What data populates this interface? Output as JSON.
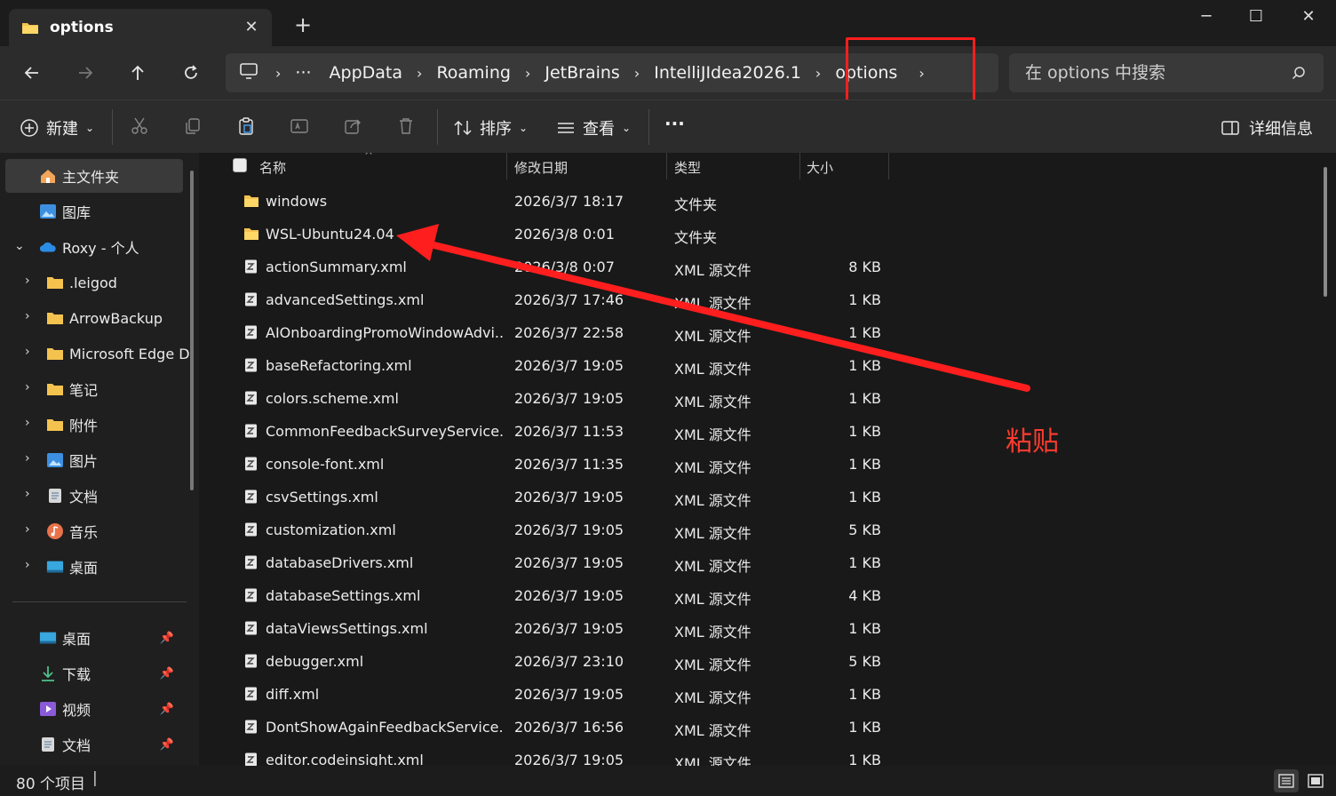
{
  "window": {
    "tab_title": "options",
    "tab_close": "✕",
    "new_tab": "+",
    "minimize": "─",
    "maximize": "☐",
    "close": "✕"
  },
  "nav": {
    "breadcrumbs": [
      "AppData",
      "Roaming",
      "JetBrains",
      "IntelliJIdea2026.1",
      "options"
    ],
    "overflow": "···",
    "search_placeholder": "在 options 中搜索"
  },
  "commands": {
    "new_label": "新建",
    "sort_label": "排序",
    "view_label": "查看",
    "more_label": "···",
    "details_label": "详细信息"
  },
  "sidebar": {
    "items": [
      {
        "label": "主文件夹",
        "icon": "home-icon"
      },
      {
        "label": "图库",
        "icon": "gallery-icon"
      },
      {
        "label": "Roxy - 个人",
        "icon": "onedrive-icon"
      },
      {
        "label": ".leigod",
        "icon": "folder-icon"
      },
      {
        "label": "ArrowBackup",
        "icon": "folder-icon"
      },
      {
        "label": "Microsoft Edge D",
        "icon": "folder-icon"
      },
      {
        "label": "笔记",
        "icon": "folder-icon"
      },
      {
        "label": "附件",
        "icon": "folder-icon"
      },
      {
        "label": "图片",
        "icon": "pictures-icon"
      },
      {
        "label": "文档",
        "icon": "documents-icon"
      },
      {
        "label": "音乐",
        "icon": "music-icon"
      },
      {
        "label": "桌面",
        "icon": "desktop-icon"
      }
    ],
    "pinned": [
      {
        "label": "桌面",
        "icon": "desktop-icon"
      },
      {
        "label": "下载",
        "icon": "download-icon"
      },
      {
        "label": "视频",
        "icon": "video-icon"
      },
      {
        "label": "文档",
        "icon": "documents-icon"
      }
    ]
  },
  "columns": {
    "name": "名称",
    "date": "修改日期",
    "type": "类型",
    "size": "大小"
  },
  "files": [
    {
      "name": "windows",
      "date": "2026/3/7 18:17",
      "type": "文件夹",
      "size": "",
      "kind": "folder"
    },
    {
      "name": "WSL-Ubuntu24.04",
      "date": "2026/3/8 0:01",
      "type": "文件夹",
      "size": "",
      "kind": "folder"
    },
    {
      "name": "actionSummary.xml",
      "date": "2026/3/8 0:07",
      "type": "XML 源文件",
      "size": "8 KB",
      "kind": "xml"
    },
    {
      "name": "advancedSettings.xml",
      "date": "2026/3/7 17:46",
      "type": "XML 源文件",
      "size": "1 KB",
      "kind": "xml"
    },
    {
      "name": "AIOnboardingPromoWindowAdvi...",
      "date": "2026/3/7 22:58",
      "type": "XML 源文件",
      "size": "1 KB",
      "kind": "xml"
    },
    {
      "name": "baseRefactoring.xml",
      "date": "2026/3/7 19:05",
      "type": "XML 源文件",
      "size": "1 KB",
      "kind": "xml"
    },
    {
      "name": "colors.scheme.xml",
      "date": "2026/3/7 19:05",
      "type": "XML 源文件",
      "size": "1 KB",
      "kind": "xml"
    },
    {
      "name": "CommonFeedbackSurveyService.x...",
      "date": "2026/3/7 11:53",
      "type": "XML 源文件",
      "size": "1 KB",
      "kind": "xml"
    },
    {
      "name": "console-font.xml",
      "date": "2026/3/7 11:35",
      "type": "XML 源文件",
      "size": "1 KB",
      "kind": "xml"
    },
    {
      "name": "csvSettings.xml",
      "date": "2026/3/7 19:05",
      "type": "XML 源文件",
      "size": "1 KB",
      "kind": "xml"
    },
    {
      "name": "customization.xml",
      "date": "2026/3/7 19:05",
      "type": "XML 源文件",
      "size": "5 KB",
      "kind": "xml"
    },
    {
      "name": "databaseDrivers.xml",
      "date": "2026/3/7 19:05",
      "type": "XML 源文件",
      "size": "1 KB",
      "kind": "xml"
    },
    {
      "name": "databaseSettings.xml",
      "date": "2026/3/7 19:05",
      "type": "XML 源文件",
      "size": "4 KB",
      "kind": "xml"
    },
    {
      "name": "dataViewsSettings.xml",
      "date": "2026/3/7 19:05",
      "type": "XML 源文件",
      "size": "1 KB",
      "kind": "xml"
    },
    {
      "name": "debugger.xml",
      "date": "2026/3/7 23:10",
      "type": "XML 源文件",
      "size": "5 KB",
      "kind": "xml"
    },
    {
      "name": "diff.xml",
      "date": "2026/3/7 19:05",
      "type": "XML 源文件",
      "size": "1 KB",
      "kind": "xml"
    },
    {
      "name": "DontShowAgainFeedbackService....",
      "date": "2026/3/7 16:56",
      "type": "XML 源文件",
      "size": "1 KB",
      "kind": "xml"
    },
    {
      "name": "editor.codeinsight.xml",
      "date": "2026/3/7 19:05",
      "type": "XML 源文件",
      "size": "1 KB",
      "kind": "xml"
    }
  ],
  "annotation": {
    "text": "粘贴",
    "color": "#ff1e1e"
  },
  "status": {
    "item_count": "80 个项目"
  },
  "colors": {
    "folder": "#f4c34f",
    "accent": "#4aa3f5"
  }
}
